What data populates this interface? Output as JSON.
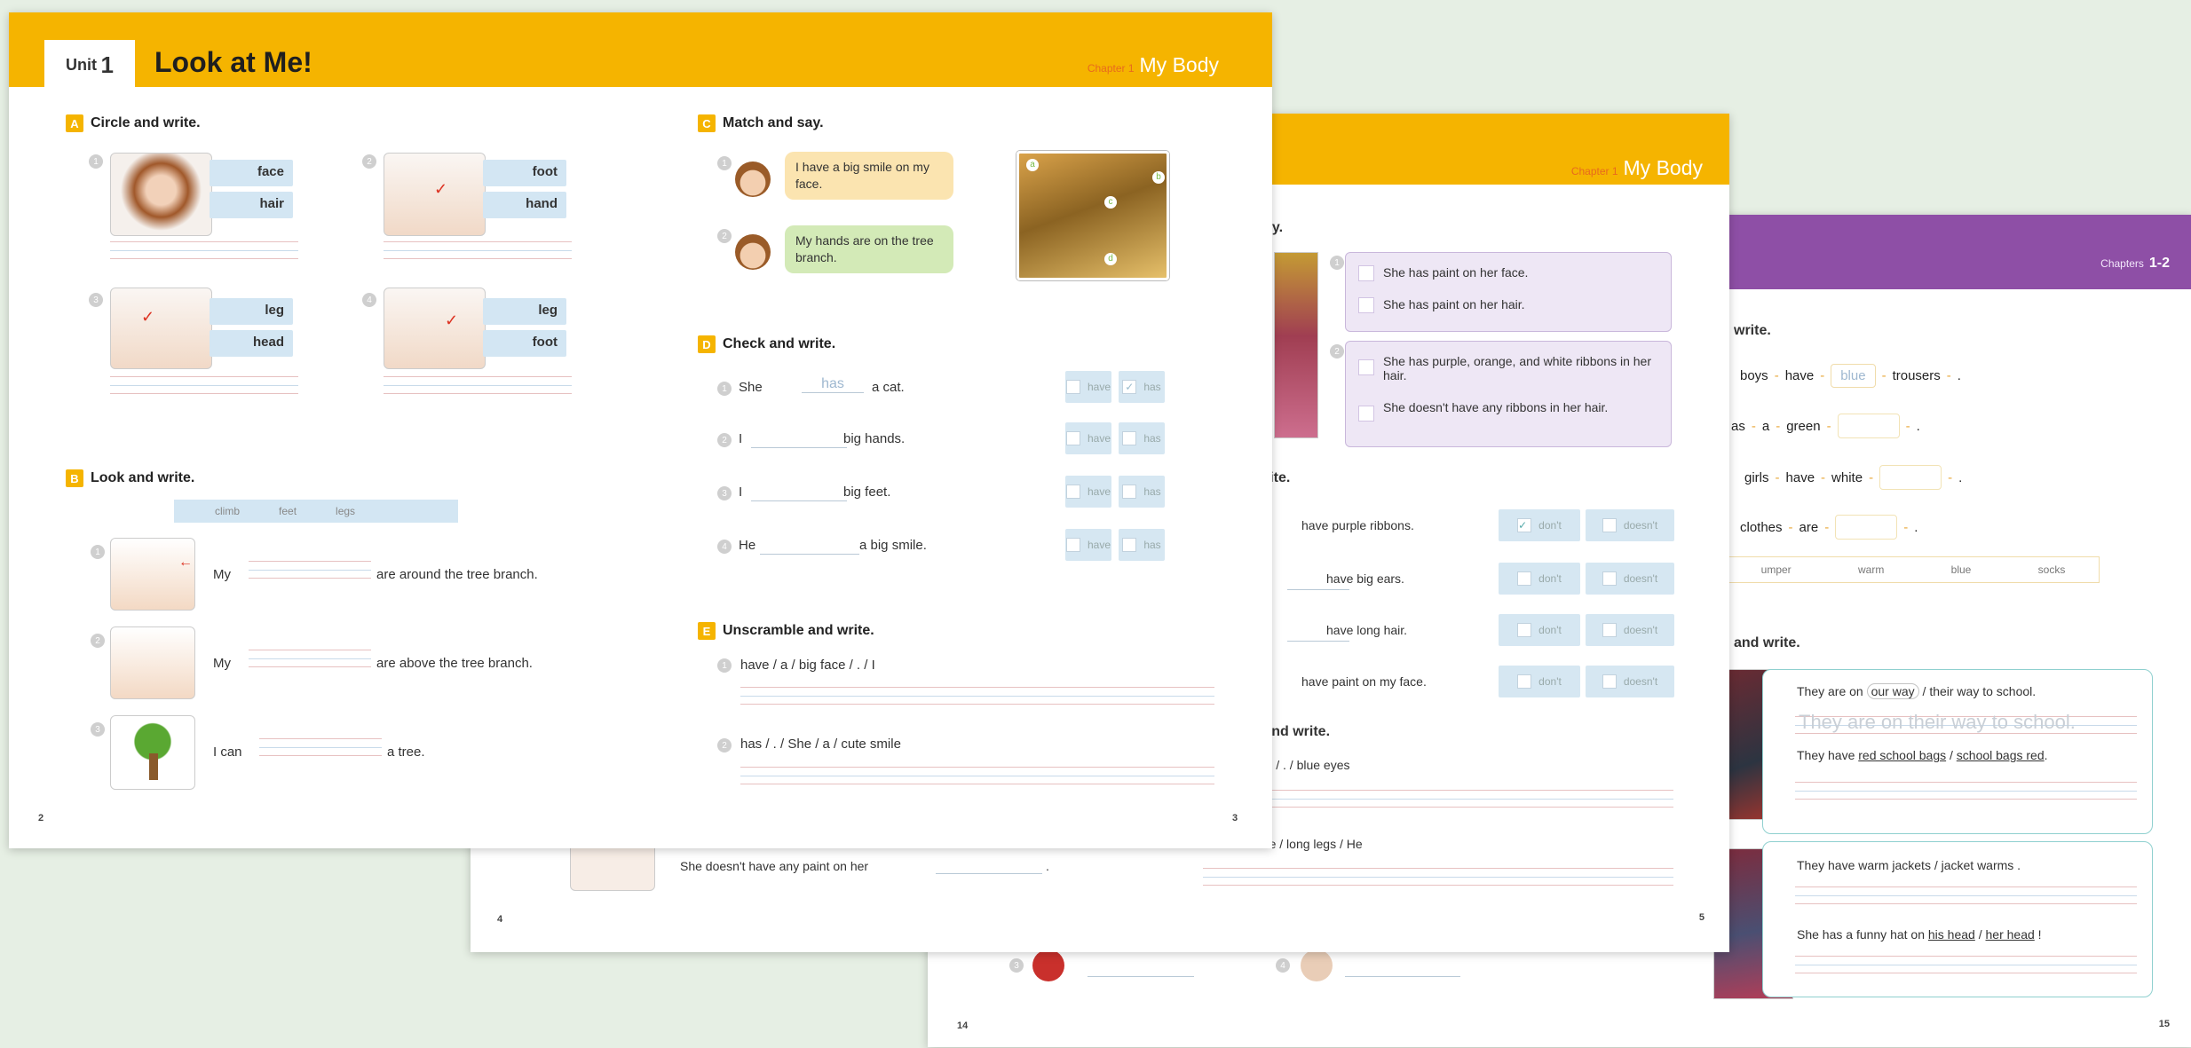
{
  "page14_15": {
    "chapter_label": "Chapters",
    "chapter_num": "1-2",
    "section_a": "write.",
    "rows": [
      {
        "words": [
          "boys",
          "have",
          "blue",
          "trousers",
          "."
        ]
      },
      {
        "words": [
          "as",
          "a",
          "green",
          "",
          "."
        ]
      },
      {
        "words": [
          "girls",
          "have",
          "white",
          "",
          "."
        ]
      },
      {
        "words": [
          "clothes",
          "are",
          "",
          "."
        ]
      }
    ],
    "word_bank": [
      "umper",
      "warm",
      "blue",
      "socks"
    ],
    "section_b": "and write.",
    "card1": [
      "They are on",
      "our way",
      "/",
      "their way",
      "to school."
    ],
    "card1_trace": "They are on their way to school.",
    "card1b": [
      "They have",
      "red school bags",
      "/",
      "school bags red",
      "."
    ],
    "card2": [
      "They have warm jackets / jacket warms ."
    ],
    "card2b": [
      "She has a funny hat on",
      "his head",
      "/",
      "her head",
      "!"
    ],
    "left_page": "14",
    "right_page": "15"
  },
  "page4_5": {
    "chapter_label": "Chapter 1",
    "chapter_title": "My Body",
    "section_c": "ay.",
    "opt1": [
      "She has paint on her face.",
      "She has paint on her hair."
    ],
    "opt2": [
      "She has purple, orange, and white ribbons in her hair.",
      "She doesn't have any ribbons in her hair."
    ],
    "section_d": "rite.",
    "d_rows": [
      {
        "text": "have purple ribbons.",
        "a": "don't",
        "b": "doesn't",
        "checked": "a"
      },
      {
        "text": "have big ears.",
        "a": "don't",
        "b": "doesn't",
        "checked": ""
      },
      {
        "text": "have long hair.",
        "a": "don't",
        "b": "doesn't",
        "checked": ""
      },
      {
        "text": "have paint on my face.",
        "a": "don't",
        "b": "doesn't",
        "checked": ""
      }
    ],
    "section_e": "e and write.",
    "e1": "e / I / . / blue eyes",
    "e2": "esn't have / long legs / He",
    "left_text": "She doesn't have any paint on her",
    "left_page": "4",
    "right_page": "5"
  },
  "page2_3": {
    "unit_label": "Unit",
    "unit_num": "1",
    "unit_title": "Look at Me!",
    "chapter_label": "Chapter 1",
    "chapter_title": "My Body",
    "sections": {
      "a": {
        "letter": "A",
        "title": "Circle and write."
      },
      "b": {
        "letter": "B",
        "title": "Look and write."
      },
      "c": {
        "letter": "C",
        "title": "Match and say."
      },
      "d": {
        "letter": "D",
        "title": "Check and write."
      },
      "e": {
        "letter": "E",
        "title": "Unscramble and write."
      }
    },
    "a_items": [
      {
        "opts": [
          "face",
          "hair"
        ]
      },
      {
        "opts": [
          "foot",
          "hand"
        ]
      },
      {
        "opts": [
          "leg",
          "head"
        ]
      },
      {
        "opts": [
          "leg",
          "foot"
        ]
      }
    ],
    "word_bank": [
      "climb",
      "feet",
      "legs"
    ],
    "b_items": [
      {
        "pre": "My",
        "post": "are around the tree branch."
      },
      {
        "pre": "My",
        "post": "are above the tree branch."
      },
      {
        "pre": "I can",
        "post": "a tree."
      }
    ],
    "c_items": [
      "I have a big smile on my face.",
      "My hands are on the tree branch."
    ],
    "c_labels": [
      "a",
      "b",
      "c",
      "d"
    ],
    "d_items": [
      {
        "subj": "She",
        "fill": "has",
        "rest": "a cat.",
        "a": "have",
        "b": "has"
      },
      {
        "subj": "I",
        "fill": "",
        "rest": "big hands.",
        "a": "have",
        "b": "has"
      },
      {
        "subj": "I",
        "fill": "",
        "rest": "big feet.",
        "a": "have",
        "b": "has"
      },
      {
        "subj": "He",
        "fill": "",
        "rest": "a big smile.",
        "a": "have",
        "b": "has"
      }
    ],
    "e_items": [
      "have / a / big face / . / I",
      "has / . / She / a / cute smile"
    ],
    "left_page": "2",
    "right_page": "3"
  },
  "colors": {
    "yellow": "#f5b400",
    "purple": "#8e4fa6",
    "light_blue": "#d3e6f3",
    "background": "#e6efe4"
  }
}
